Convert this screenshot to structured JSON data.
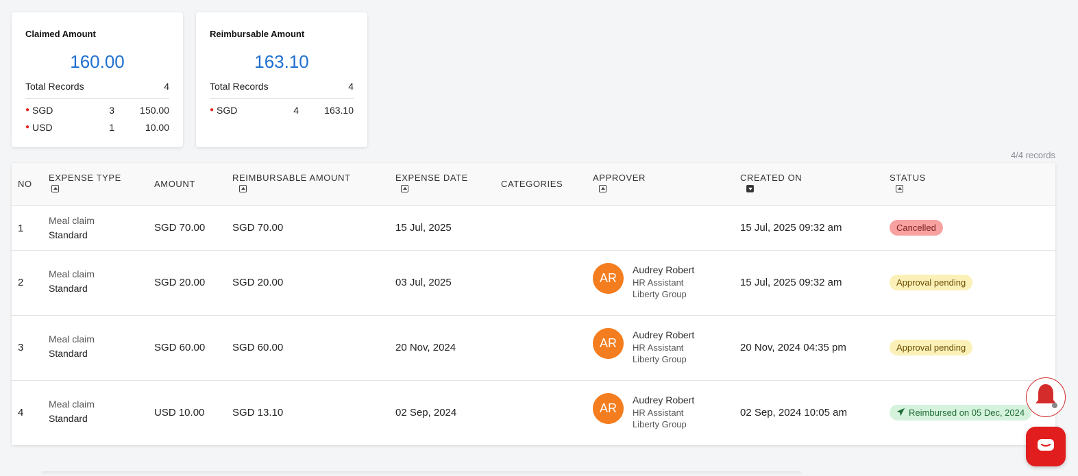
{
  "summary": {
    "claimed": {
      "title": "Claimed Amount",
      "value": "160.00",
      "total_label": "Total Records",
      "total_count": "4",
      "currencies": [
        {
          "code": "SGD",
          "count": "3",
          "amount": "150.00"
        },
        {
          "code": "USD",
          "count": "1",
          "amount": "10.00"
        }
      ]
    },
    "reimbursable": {
      "title": "Reimbursable Amount",
      "value": "163.10",
      "total_label": "Total Records",
      "total_count": "4",
      "currencies": [
        {
          "code": "SGD",
          "count": "4",
          "amount": "163.10"
        }
      ]
    }
  },
  "records_label": "4/4 records",
  "table": {
    "headers": {
      "no": "NO",
      "expense_type": "EXPENSE TYPE",
      "amount": "AMOUNT",
      "reimbursable_amount": "REIMBURSABLE AMOUNT",
      "expense_date": "EXPENSE DATE",
      "categories": "CATEGORIES",
      "approver": "APPROVER",
      "created_on": "CREATED ON",
      "status": "STATUS"
    },
    "rows": [
      {
        "no": "1",
        "type": "Meal claim",
        "subtype": "Standard",
        "amount": "SGD 70.00",
        "reimbursable": "SGD 70.00",
        "expense_date": "15 Jul, 2025",
        "category": "",
        "approver": {
          "initials": "",
          "name": "",
          "role": "",
          "company": ""
        },
        "created_on": "15 Jul, 2025 09:32 am",
        "status": "Cancelled"
      },
      {
        "no": "2",
        "type": "Meal claim",
        "subtype": "Standard",
        "amount": "SGD 20.00",
        "reimbursable": "SGD 20.00",
        "expense_date": "03 Jul, 2025",
        "category": "",
        "approver": {
          "initials": "AR",
          "name": "Audrey Robert",
          "role": "HR Assistant",
          "company": "Liberty Group"
        },
        "created_on": "15 Jul, 2025 09:32 am",
        "status": "Approval pending"
      },
      {
        "no": "3",
        "type": "Meal claim",
        "subtype": "Standard",
        "amount": "SGD 60.00",
        "reimbursable": "SGD 60.00",
        "expense_date": "20 Nov, 2024",
        "category": "",
        "approver": {
          "initials": "AR",
          "name": "Audrey Robert",
          "role": "HR Assistant",
          "company": "Liberty Group"
        },
        "created_on": "20 Nov, 2024 04:35 pm",
        "status": "Approval pending"
      },
      {
        "no": "4",
        "type": "Meal claim",
        "subtype": "Standard",
        "amount": "USD 10.00",
        "reimbursable": "SGD 13.10",
        "expense_date": "02 Sep, 2024",
        "category": "",
        "approver": {
          "initials": "AR",
          "name": "Audrey Robert",
          "role": "HR Assistant",
          "company": "Liberty Group"
        },
        "created_on": "02 Sep, 2024 10:05 am",
        "status": "Reimbursed on 05 Dec, 2024"
      }
    ]
  },
  "colors": {
    "accent": "#1f6fd1",
    "avatar": "#f47d1f",
    "cancelled": "#f7a1a1",
    "pending": "#fbf1b8",
    "reimbursed": "#d4f2dc",
    "fab": "#e11d1d"
  },
  "icons": {
    "sort": "sort-icon",
    "bell": "bell-icon",
    "chat": "chat-icon",
    "send": "paper-plane-icon"
  }
}
